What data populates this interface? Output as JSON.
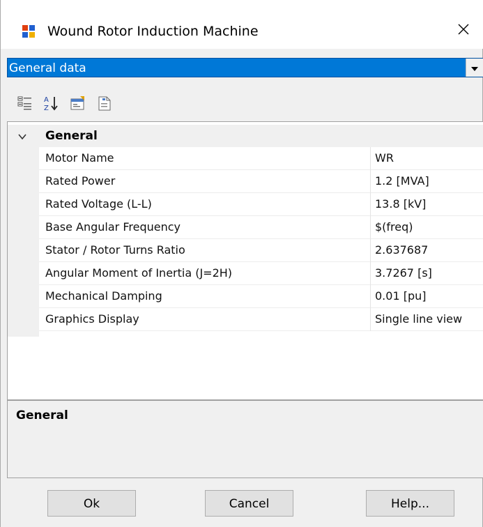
{
  "window": {
    "title": "Wound Rotor Induction Machine",
    "icon": "app-window-icon",
    "close_icon": "close-icon"
  },
  "section_select": {
    "selected": "General data"
  },
  "toolbar": {
    "icons": [
      "categorized-icon",
      "sort-alpha-icon",
      "property-pages-icon",
      "document-icon"
    ]
  },
  "grid": {
    "category": "General",
    "properties": [
      {
        "name": "Motor Name",
        "value": "WR"
      },
      {
        "name": "Rated Power",
        "value": "1.2 [MVA]"
      },
      {
        "name": "Rated Voltage (L-L)",
        "value": "13.8 [kV]"
      },
      {
        "name": "Base Angular Frequency",
        "value": "$(freq)"
      },
      {
        "name": "Stator / Rotor Turns Ratio",
        "value": "2.637687"
      },
      {
        "name": "Angular Moment of Inertia (J=2H)",
        "value": "3.7267 [s]"
      },
      {
        "name": "Mechanical Damping",
        "value": "0.01 [pu]"
      },
      {
        "name": "Graphics Display",
        "value": "Single line view"
      }
    ]
  },
  "description": {
    "title": "General"
  },
  "buttons": {
    "ok": "Ok",
    "cancel": "Cancel",
    "help": "Help..."
  },
  "colors": {
    "selection": "#0078d7",
    "window_bg": "#f0f0f0"
  }
}
